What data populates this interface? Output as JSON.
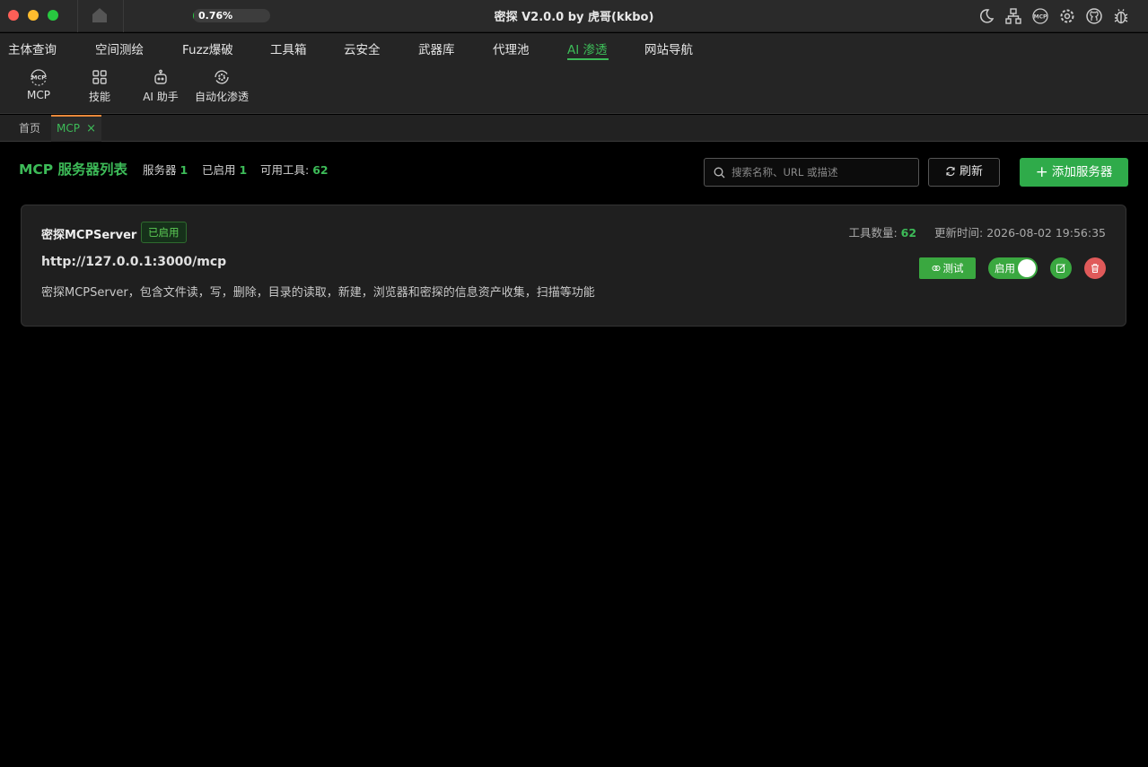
{
  "window": {
    "title": "密探 V2.0.0 by 虎哥(kkbo)",
    "progress_text": "0.76%",
    "progress_value": 0.0076
  },
  "titlebar_icons": [
    "moon-icon",
    "network-icon",
    "mcp-icon",
    "settings-icon",
    "github-icon",
    "bug-icon"
  ],
  "menu": {
    "items": [
      "主体查询",
      "空间测绘",
      "Fuzz爆破",
      "工具箱",
      "云安全",
      "武器库",
      "代理池",
      "AI 渗透",
      "网站导航"
    ],
    "active": "AI 渗透",
    "sub_items": [
      "MCP",
      "技能",
      "AI 助手",
      "自动化渗透"
    ]
  },
  "tabs": {
    "home": "首页",
    "active": "MCP",
    "close": "×"
  },
  "page": {
    "title": "MCP 服务器列表",
    "stats": {
      "servers_label": "服务器",
      "servers_count": "1",
      "enabled_label": "已启用",
      "enabled_count": "1",
      "tools_label": "可用工具:",
      "tools_count": "62"
    },
    "search_placeholder": "搜索名称、URL 或描述",
    "refresh_label": "刷新",
    "add_label": "添加服务器"
  },
  "servers": [
    {
      "name": "密探MCPServer",
      "status": "已启用",
      "url": "http://127.0.0.1:3000/mcp",
      "description": "密探MCPServer，包含文件读，写，删除，目录的读取，新建，浏览器和密探的信息资产收集，扫描等功能",
      "tools_label": "工具数量:",
      "tools_count": "62",
      "updated_label": "更新时间:",
      "updated_at": "2026-08-02 19:56:35",
      "test_label": "测试",
      "toggle_label": "启用",
      "enabled": true
    }
  ],
  "colors": {
    "accent": "#3dbb58",
    "tab_indicator": "#e8883a",
    "danger": "#e05a5a"
  }
}
